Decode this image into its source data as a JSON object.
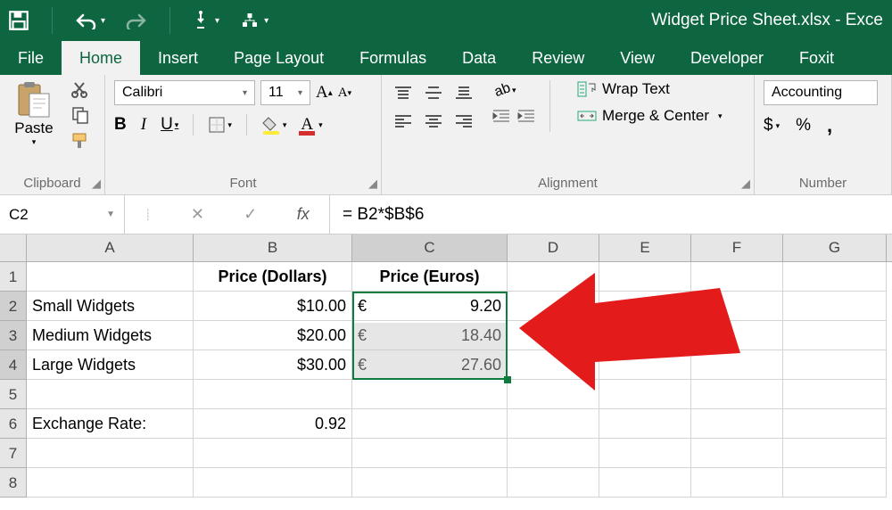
{
  "title": "Widget Price Sheet.xlsx - Exce",
  "tabs": [
    "File",
    "Home",
    "Insert",
    "Page Layout",
    "Formulas",
    "Data",
    "Review",
    "View",
    "Developer",
    "Foxit"
  ],
  "activeTab": 1,
  "clipboard": {
    "paste": "Paste",
    "group": "Clipboard"
  },
  "font": {
    "name": "Calibri",
    "size": "11",
    "bold": "B",
    "italic": "I",
    "underline": "U",
    "group": "Font"
  },
  "alignment": {
    "wrap": "Wrap Text",
    "merge": "Merge & Center",
    "group": "Alignment"
  },
  "number": {
    "format": "Accounting",
    "currency": "$",
    "percent": "%",
    "comma": ",",
    "group": "Number"
  },
  "nameBox": "C2",
  "formula": "= B2*$B$6",
  "fx": "fx",
  "columns": [
    "A",
    "B",
    "C",
    "D",
    "E",
    "F",
    "G"
  ],
  "colWidths": [
    "cA",
    "cB",
    "cC",
    "cD",
    "cE",
    "cF",
    "cG"
  ],
  "rows": [
    "1",
    "2",
    "3",
    "4",
    "5",
    "6",
    "7",
    "8"
  ],
  "cells": {
    "B1": "Price (Dollars)",
    "C1": "Price (Euros)",
    "A2": "Small Widgets",
    "B2": "$10.00",
    "C2s": "€",
    "C2v": "9.20",
    "A3": "Medium Widgets",
    "B3": "$20.00",
    "C3s": "€",
    "C3v": "18.40",
    "A4": "Large Widgets",
    "B4": "$30.00",
    "C4s": "€",
    "C4v": "27.60",
    "A6": "Exchange Rate:",
    "B6": "0.92"
  },
  "chart_data": null
}
